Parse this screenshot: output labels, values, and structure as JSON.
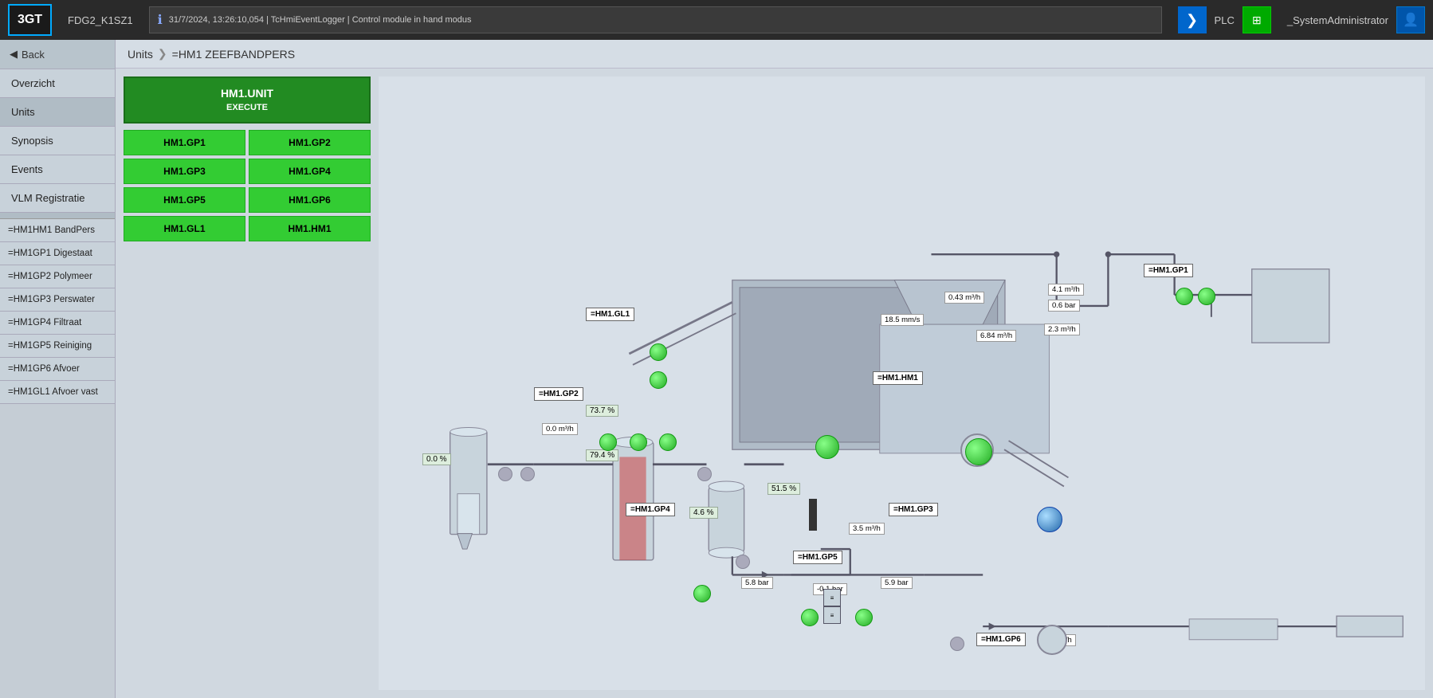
{
  "header": {
    "logo": "3GT",
    "device": "FDG2_K1SZ1",
    "info_timestamp": "31/7/2024, 13:26:10,054",
    "info_logger": "TcHmiEventLogger",
    "info_message": "Control module in hand modus",
    "nav_arrow": "❯",
    "plc_label": "PLC",
    "plc_icon": "⊞",
    "user_name": "_SystemAdministrator",
    "user_icon": "👤"
  },
  "breadcrumb": {
    "units": "Units",
    "sep": "❯",
    "current": "=HM1 ZEEFBANDPERS"
  },
  "sidebar": {
    "back_label": "Back",
    "items": [
      {
        "label": "Overzicht",
        "id": "overzicht"
      },
      {
        "label": "Units",
        "id": "units"
      },
      {
        "label": "Synopsis",
        "id": "synopsis"
      },
      {
        "label": "Events",
        "id": "events"
      },
      {
        "label": "VLM Registratie",
        "id": "vlm"
      }
    ],
    "sub_items": [
      {
        "label": "=HM1HM1 BandPers",
        "id": "hm1hm1"
      },
      {
        "label": "=HM1GP1 Digestaat",
        "id": "hm1gp1"
      },
      {
        "label": "=HM1GP2 Polymeer",
        "id": "hm1gp2"
      },
      {
        "label": "=HM1GP3 Perswater",
        "id": "hm1gp3"
      },
      {
        "label": "=HM1GP4 Filtraat",
        "id": "hm1gp4"
      },
      {
        "label": "=HM1GP5 Reiniging",
        "id": "hm1gp5"
      },
      {
        "label": "=HM1GP6 Afvoer",
        "id": "hm1gp6"
      },
      {
        "label": "=HM1GL1 Afvoer vast",
        "id": "hm1gl1"
      }
    ]
  },
  "unit_btn": {
    "line1": "HM1.UNIT",
    "line2": "EXECUTE"
  },
  "gp_buttons": [
    "HM1.GP1",
    "HM1.GP2",
    "HM1.GP3",
    "HM1.GP4",
    "HM1.GP5",
    "HM1.GP6",
    "HM1.GL1",
    "HM1.HM1"
  ],
  "diagram": {
    "labels": {
      "hm1_gl1": "=HM1.GL1",
      "hm1_hm1": "=HM1.HM1",
      "hm1_gp1": "=HM1.GP1",
      "hm1_gp2": "=HM1.GP2",
      "hm1_gp3": "=HM1.GP3",
      "hm1_gp4": "=HM1.GP4",
      "hm1_gp5": "=HM1.GP5",
      "hm1_gp6": "=HM1.GP6"
    },
    "values": {
      "v1": "0.0 m³/h",
      "v2": "18.5 mm/s",
      "v3": "0.43 m³/h",
      "v4": "4.1 m³/h",
      "v5": "0.6 bar",
      "v6": "6.84 m³/h",
      "v7": "2.3 m³/h",
      "v8": "3.5 m³/h",
      "v9": "5.8 bar",
      "v10": "-0.1 bar",
      "v11": "5.9 bar",
      "v12": "0.0 m³/h"
    },
    "percents": {
      "p1": "73.7 %",
      "p2": "79.4 %",
      "p3": "51.5 %",
      "p4": "4.6 %",
      "p5": "0.0 %"
    }
  },
  "colors": {
    "green_active": "#22aa22",
    "sidebar_bg": "#c8d2da",
    "header_bg": "#2a2a2a",
    "plc_green": "#00aa00",
    "diagram_bg": "#d8e0e8"
  }
}
